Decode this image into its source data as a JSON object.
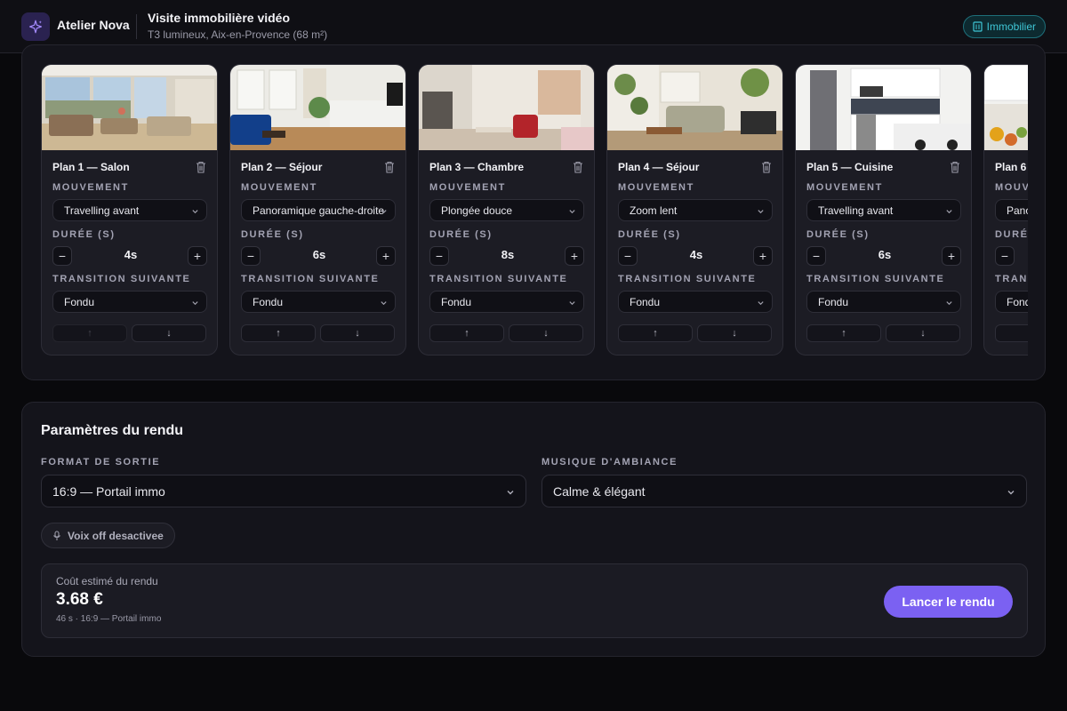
{
  "app": {
    "brand": "Atelier Nova",
    "accent": "#7b61f2"
  },
  "header": {
    "title": "Visite immobilière vidéo",
    "subtitle": "T3 lumineux, Aix-en-Provence (68 m²)",
    "badge": "Immobilier"
  },
  "labels": {
    "movement": "MOUVEMENT",
    "duration": "DURÉE (S)",
    "transition": "TRANSITION SUIVANTE"
  },
  "shots": [
    {
      "title": "Plan 1 — Salon",
      "movement": "Travelling avant",
      "duration": "4s",
      "transition": "Fondu"
    },
    {
      "title": "Plan 2 — Séjour",
      "movement": "Panoramique gauche-droite",
      "duration": "6s",
      "transition": "Fondu"
    },
    {
      "title": "Plan 3 — Chambre",
      "movement": "Plongée douce",
      "duration": "8s",
      "transition": "Fondu"
    },
    {
      "title": "Plan 4 — Séjour",
      "movement": "Zoom lent",
      "duration": "4s",
      "transition": "Fondu"
    },
    {
      "title": "Plan 5 — Cuisine",
      "movement": "Travelling avant",
      "duration": "6s",
      "transition": "Fondu"
    },
    {
      "title": "Plan 6",
      "movement": "Panoramique",
      "duration": "",
      "transition": "Fondu"
    }
  ],
  "render": {
    "title": "Paramètres du rendu",
    "format_label": "FORMAT DE SORTIE",
    "format_value": "16:9 — Portail immo",
    "music_label": "MUSIQUE D'AMBIANCE",
    "music_value": "Calme & élégant",
    "voice_toggle": "Voix off desactivee",
    "cost_label": "Coût estimé du rendu",
    "cost_value": "3.68 €",
    "cost_meta": "46 s · 16:9 — Portail immo",
    "launch_label": "Lancer le rendu"
  }
}
